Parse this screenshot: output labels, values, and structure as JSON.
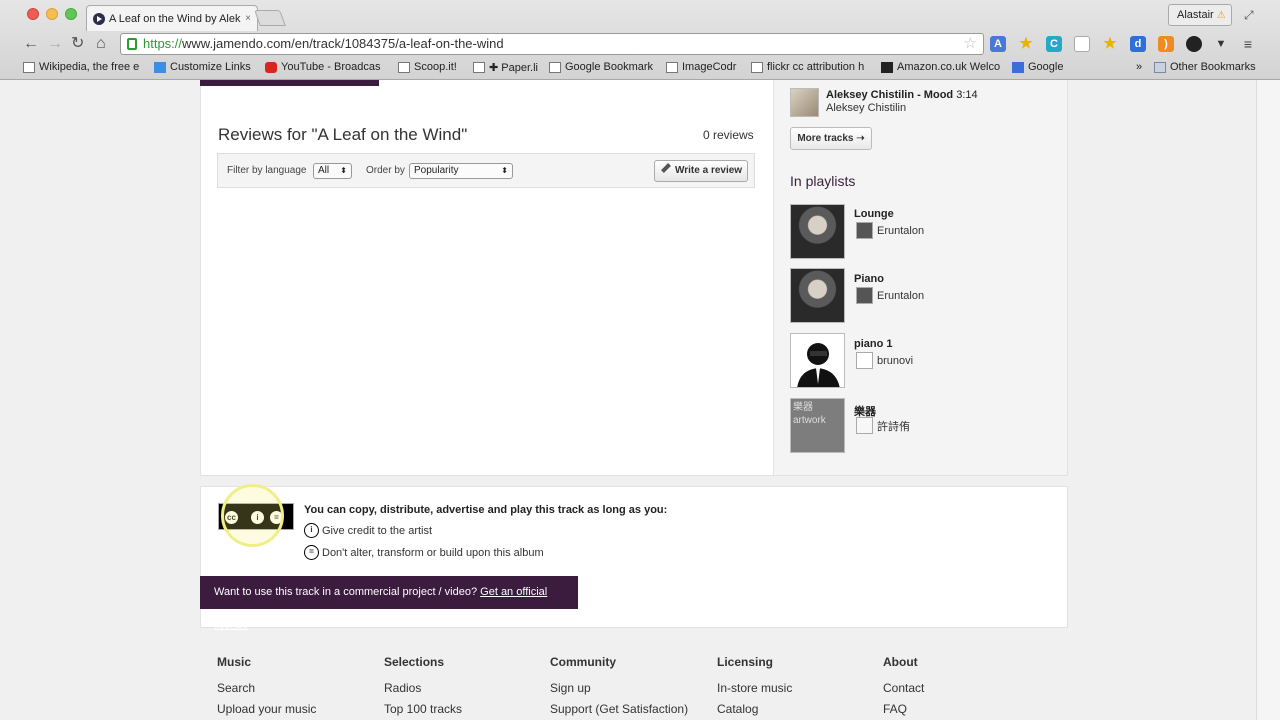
{
  "browser": {
    "tab_title": "A Leaf on the Wind by Alek",
    "tab_close": "×",
    "profile_name": "Alastair",
    "profile_warning": "⚠",
    "url_scheme": "https://",
    "url_rest": "www.jamendo.com/en/track/1084375/a-leaf-on-the-wind",
    "bookmarks": [
      {
        "label": "Wikipedia, the free e"
      },
      {
        "label": "Customize Links"
      },
      {
        "label": "YouTube - Broadcas"
      },
      {
        "label": "Scoop.it!"
      },
      {
        "label": "✚ Paper.li"
      },
      {
        "label": "Google Bookmark"
      },
      {
        "label": "ImageCodr"
      },
      {
        "label": "flickr cc attribution h"
      },
      {
        "label": "Amazon.co.uk Welco"
      },
      {
        "label": "Google"
      }
    ],
    "bookmarks_overflow": "»",
    "other_bookmarks": "Other Bookmarks"
  },
  "reviews": {
    "title": "Reviews for \"A Leaf on the Wind\"",
    "count": "0 reviews",
    "filter_label": "Filter by language",
    "filter_value": "All",
    "order_label": "Order by",
    "order_value": "Popularity",
    "write_button": "Write a review"
  },
  "sidebar": {
    "track_title": "Aleksey Chistilin - Mood",
    "track_duration": "3:14",
    "track_artist": "Aleksey Chistilin",
    "more_tracks": "More tracks ➝",
    "playlists_title": "In playlists",
    "playlists": [
      {
        "name": "Lounge",
        "user": "Eruntalon"
      },
      {
        "name": "Piano",
        "user": "Eruntalon"
      },
      {
        "name": "piano 1",
        "user": "brunovi"
      },
      {
        "name": "樂器",
        "user": "許詩侑",
        "image_alt": "樂器 artwork"
      }
    ]
  },
  "license": {
    "heading": "You can copy, distribute, advertise and play this track as long as you:",
    "items": [
      {
        "icon": "attribution-icon",
        "text": "Give credit to the artist"
      },
      {
        "icon": "no-derivatives-icon",
        "text": "Don't alter, transform or build upon this album"
      }
    ],
    "commercial_text": "Want to use this track in a commercial project / video?",
    "commercial_link": "Get an official license"
  },
  "footer": {
    "columns": [
      {
        "heading": "Music",
        "links": [
          "Search",
          "Upload your music"
        ]
      },
      {
        "heading": "Selections",
        "links": [
          "Radios",
          "Top 100 tracks"
        ]
      },
      {
        "heading": "Community",
        "links": [
          "Sign up",
          "Support (Get Satisfaction)"
        ]
      },
      {
        "heading": "Licensing",
        "links": [
          "In-store music",
          "Catalog"
        ]
      },
      {
        "heading": "About",
        "links": [
          "Contact",
          "FAQ"
        ]
      }
    ]
  },
  "colors": {
    "brand_purple": "#3b1b3e",
    "secure_green": "#2e9b32"
  }
}
